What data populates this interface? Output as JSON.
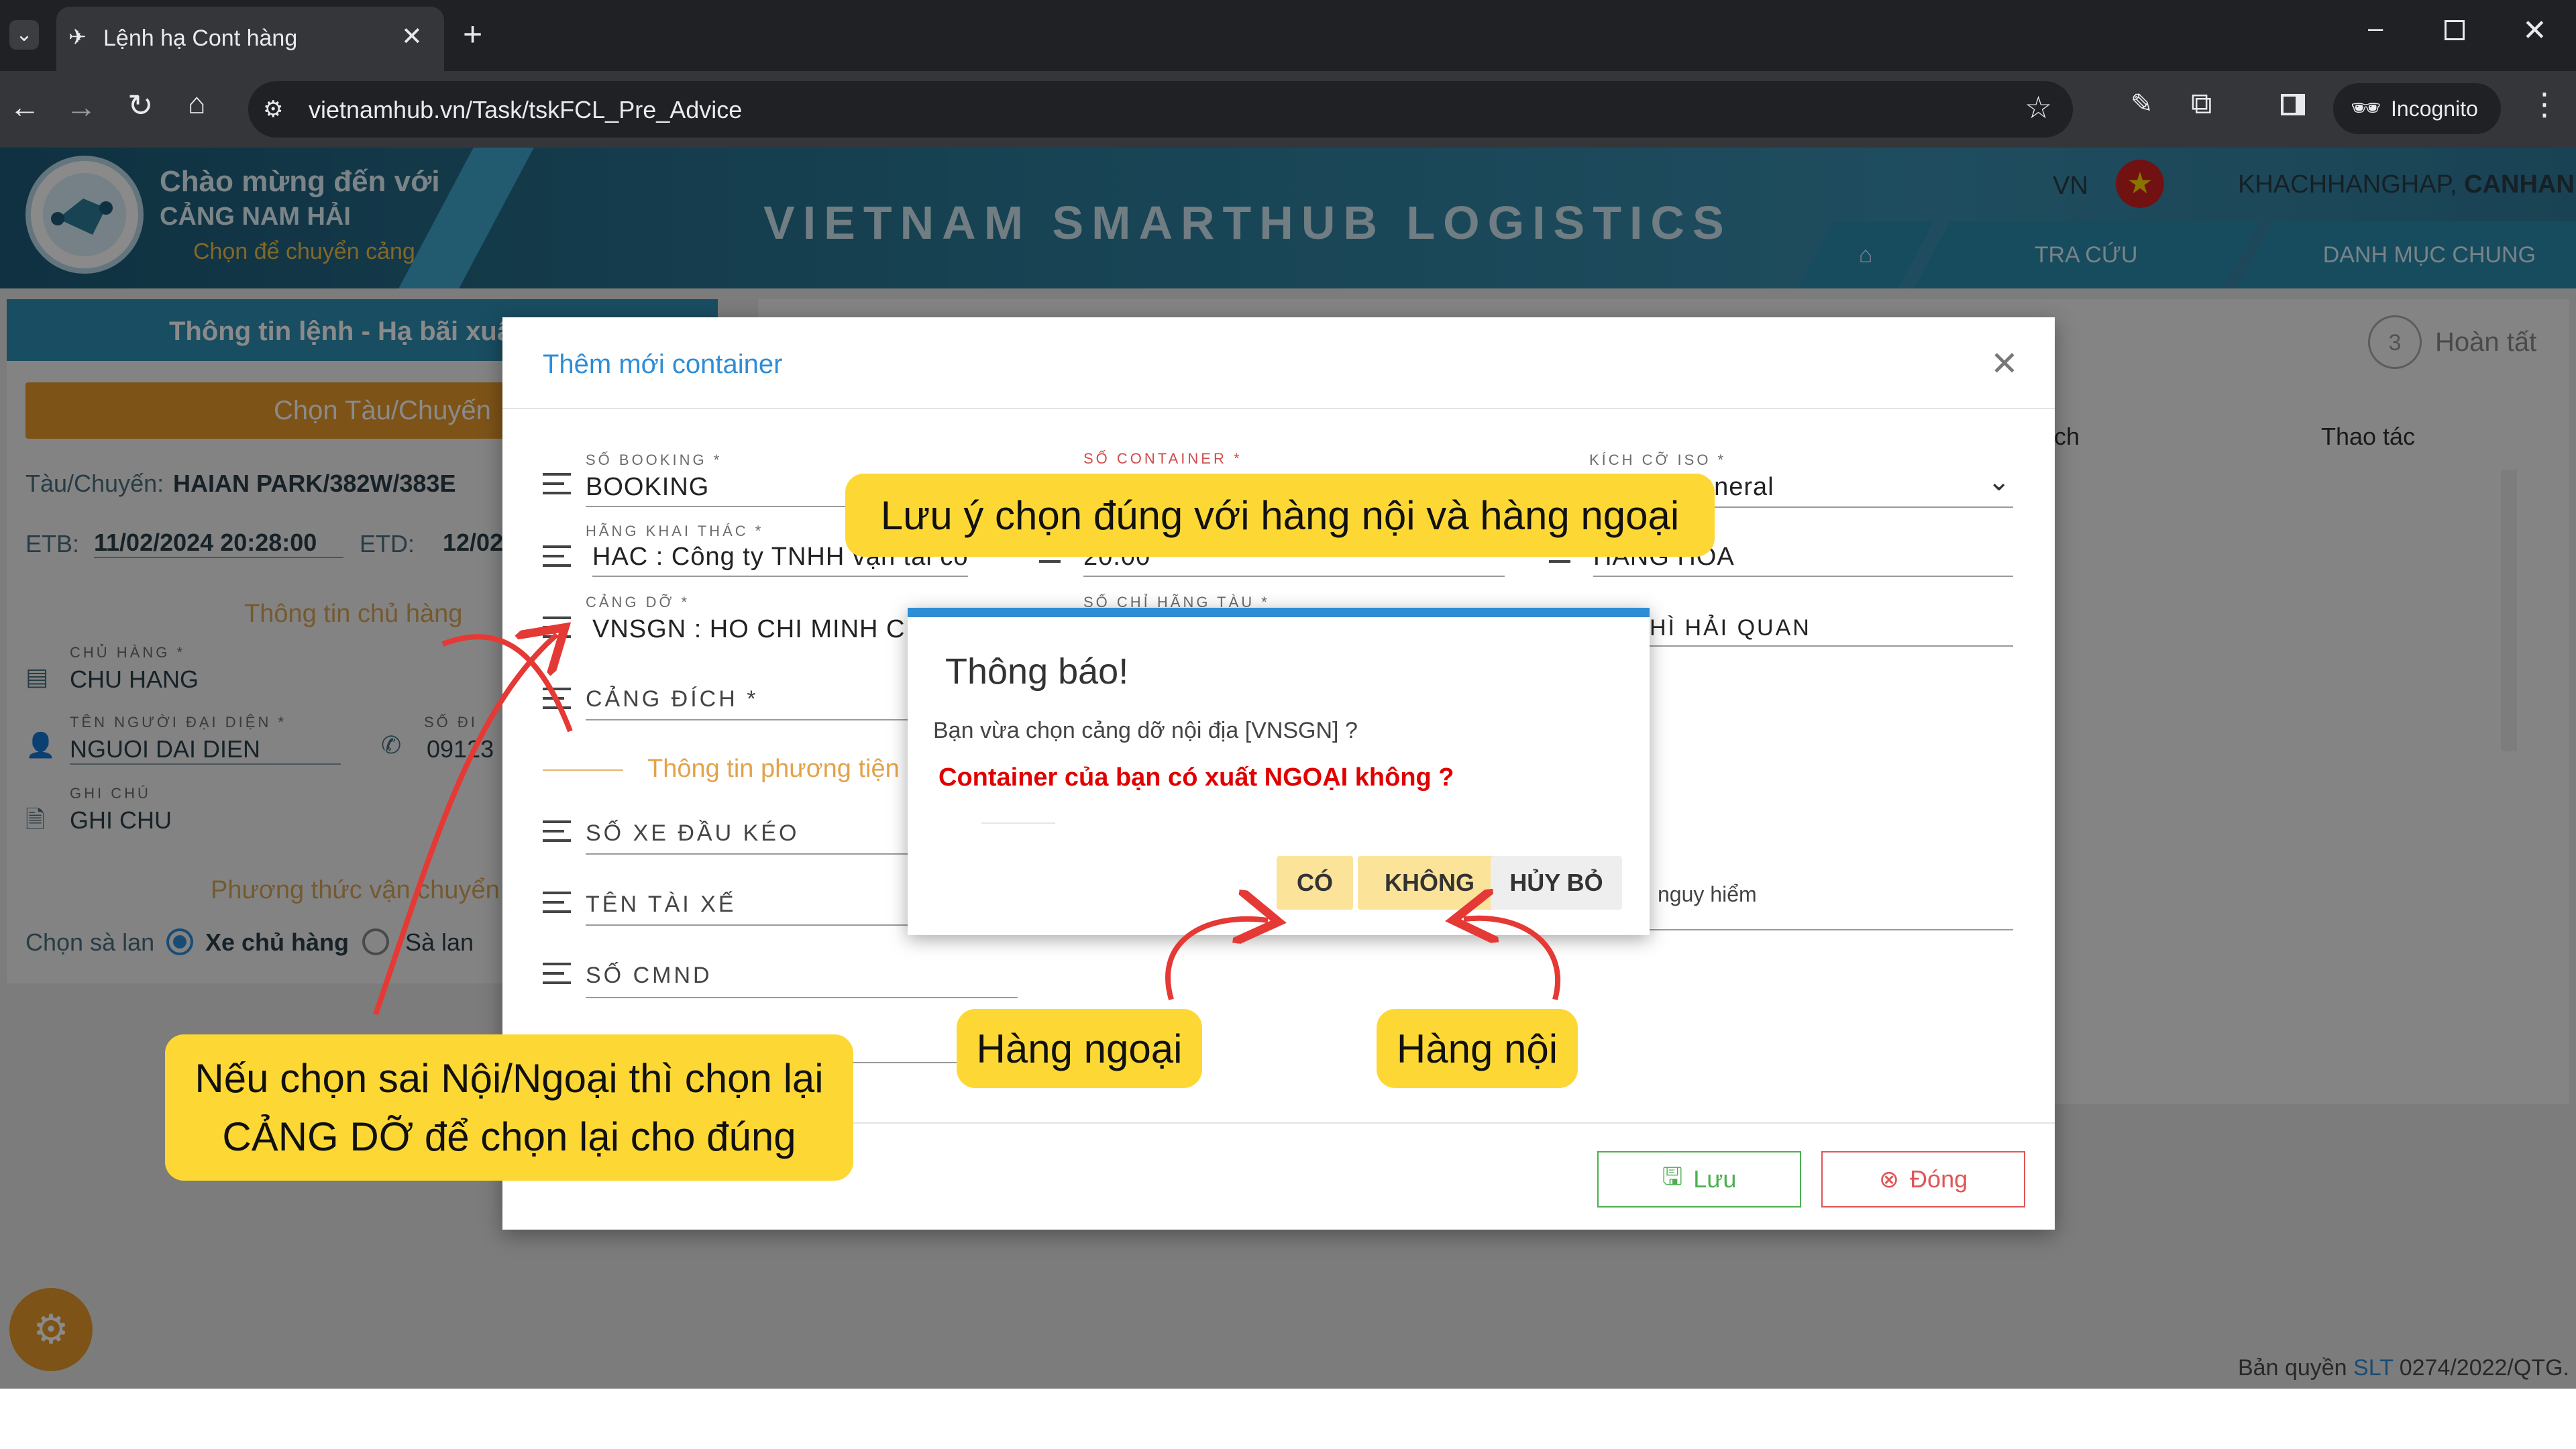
{
  "browser": {
    "tab_title": "Lệnh hạ Cont hàng",
    "url": "vietnamhub.vn/Task/tskFCL_Pre_Advice",
    "incognito_label": "Incognito"
  },
  "header": {
    "welcome_line1": "Chào mừng đến với",
    "welcome_line2": "CẢNG NAM HẢI",
    "welcome_line3": "Chọn để chuyển cảng",
    "brand_title": "VIETNAM SMARTHUB LOGISTICS",
    "language": "VN",
    "user_prefix": "KHACHHANGHAP, ",
    "user_name": "CANHAN",
    "nav_items": [
      "TRA CỨU",
      "DANH MỤC CHUNG"
    ]
  },
  "background": {
    "panel_title": "Thông tin lệnh - Hạ bãi xuất",
    "choose_vessel_button": "Chọn Tàu/Chuyến",
    "vessel_label": "Tàu/Chuyến:",
    "vessel_value": "HAIAN PARK/382W/383E",
    "etb_label": "ETB:",
    "etb_value": "11/02/2024 20:28:00",
    "etd_label": "ETD:",
    "etd_value": "12/02",
    "owner_section": "Thông tin chủ hàng",
    "owner_label": "CHỦ HÀNG *",
    "owner_value": "CHU HANG",
    "rep_label": "TÊN NGƯỜI ĐẠI DIỆN *",
    "rep_value": "NGUOI DAI DIEN",
    "phone_label": "SỐ ĐI",
    "phone_value": "09123",
    "note_label": "GHI CHÚ",
    "note_value": "GHI CHU",
    "transport_section": "Phương thức vận chuyển",
    "barge_label": "Chọn sà lan",
    "radio_truck": "Xe chủ hàng",
    "radio_barge": "Sà lan",
    "step3_number": "3",
    "step3_label": "Hoàn tất",
    "col_ch": "ch",
    "col_actions": "Thao tác",
    "copyright_prefix": "Bản quyền ",
    "copyright_link": "SLT",
    "copyright_suffix": " 0274/2022/QTG."
  },
  "modal": {
    "title": "Thêm mới container",
    "booking_label": "SỐ BOOKING *",
    "booking_value": "BOOKING",
    "container_label": "SỐ CONTAINER *",
    "iso_label": "KÍCH CỠ ISO *",
    "iso_value": "eneral",
    "operator_label": "HÃNG KHAI THÁC *",
    "operator_value": "HAC : Công ty TNHH vận tải conl",
    "weight_value": "20.00",
    "cargo_value": "HANG HOA",
    "pol_label": "CẢNG DỠ *",
    "pol_value": "VNSGN : HO CHI MINH CITY",
    "seal_label": "SỐ CHỈ HÃNG TÀU *",
    "customs_seal_value": "HÌ HẢI QUAN",
    "dest_port_label": "CẢNG ĐÍCH *",
    "vehicle_section": "Thông tin phương tiện",
    "truck_label": "SỐ XE ĐẦU KÉO",
    "driver_label": "TÊN TÀI XẾ",
    "id_label": "SỐ CMND",
    "danger_label": "nguy hiểm",
    "save_button": "Lưu",
    "close_button": "Đóng"
  },
  "dialog": {
    "title": "Thông báo!",
    "message": "Bạn vừa chọn cảng dỡ nội địa [VNSGN] ?",
    "question": "Container của bạn có xuất NGOẠI không ?",
    "yes_button": "CÓ",
    "no_button": "KHÔNG",
    "cancel_button": "HỦY BỎ"
  },
  "callouts": {
    "top_note": "Lưu ý chọn đúng với hàng nội và hàng ngoại",
    "left_note_line1": "Nếu chọn sai Nội/Ngoại thì chọn lại",
    "left_note_line2": "CẢNG DỠ để chọn lại cho đúng",
    "foreign_label": "Hàng ngoại",
    "domestic_label": "Hàng nội"
  },
  "colors": {
    "accent_blue": "#2f8dd6",
    "highlight_yellow": "#fdd835",
    "button_yellow": "#fbe39a",
    "banner_teal": "#2b7c9a",
    "alert_red": "#e00000"
  }
}
